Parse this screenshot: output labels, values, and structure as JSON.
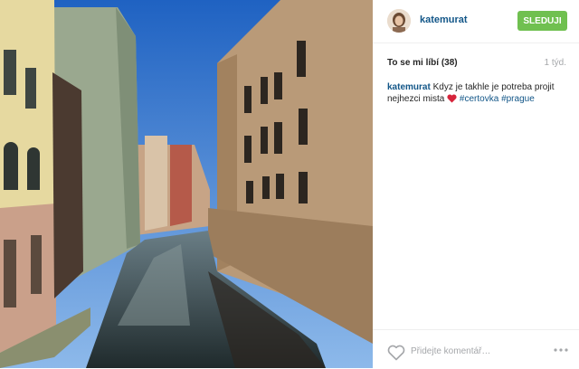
{
  "post": {
    "photo_icon": "photo-canal-prague"
  },
  "header": {
    "username": "katemurat",
    "follow_label": "SLEDUJI",
    "follow_color": "#70c050"
  },
  "stats": {
    "likes_label": "To se mi líbí (38)",
    "time": "1 týd."
  },
  "caption": {
    "user": "katemurat",
    "text": "Kdyz je takhle je potreba projit nejhezci mista",
    "emoji": "red-heart-icon",
    "tags": [
      "#certovka",
      "#prague"
    ]
  },
  "footer": {
    "comment_placeholder": "Přidejte komentář…",
    "like_icon": "heart-outline-icon",
    "more_icon": "more-dots-icon"
  },
  "colors": {
    "accent": "#125688",
    "text": "#262626",
    "muted": "#a5a7aa"
  }
}
